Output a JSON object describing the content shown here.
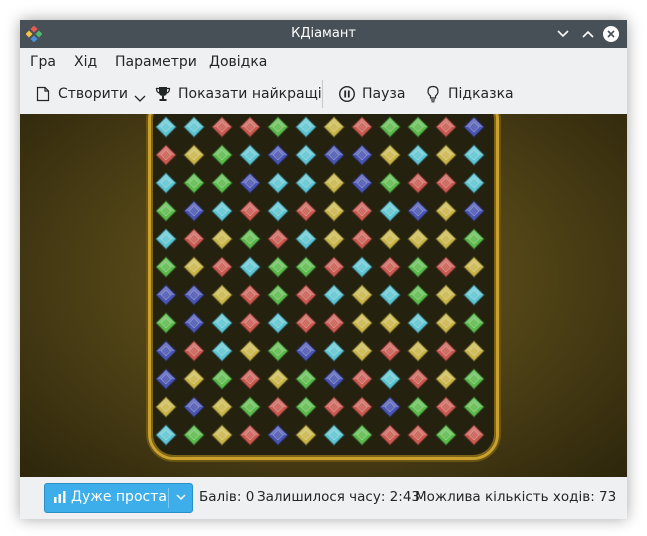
{
  "window": {
    "title": "КДіамант"
  },
  "menu": {
    "items": [
      "Гра",
      "Хід",
      "Параметри",
      "Довідка"
    ]
  },
  "toolbar": {
    "new_label": "Створити",
    "highscores_label": "Показати найкращі",
    "pause_label": "Пауза",
    "hint_label": "Підказка"
  },
  "status": {
    "difficulty": "Дуже проста",
    "score_text": "Балів: 0",
    "time_text": "Залишилося часу: 2:43",
    "moves_text": "Можлива кількість ходів: 73"
  },
  "board": {
    "rows": 12,
    "cols": 12,
    "gem_colors": {
      "C": "#5ec4d0",
      "Y": "#c8b448",
      "R": "#c85a50",
      "G": "#5cba4c",
      "B": "#4a56b2"
    },
    "grid": [
      "CCRRGCYRGGRB",
      "RYGCBCBBYCYC",
      "CGGBCCYBGRRC",
      "GBCRCRYRCBYB",
      "CRYGRCYRYYYG",
      "GYRCGGRCRGRY",
      "BBYRGRCYCGYC",
      "GBCRCRRYYCYG",
      "BRCYGBCYRYRY",
      "BYGRYGBRCRYG",
      "YBYGRGRRBGRG",
      "CGYRBYCGRRGR"
    ]
  }
}
